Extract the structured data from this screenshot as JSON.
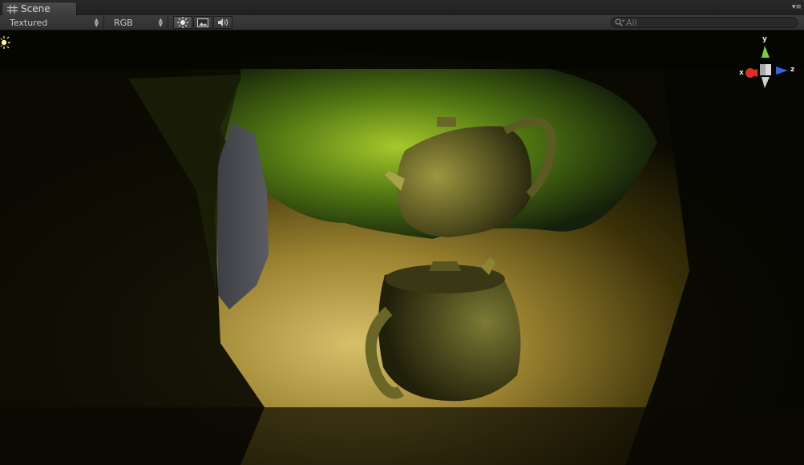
{
  "tab": {
    "title": "Scene"
  },
  "toolbar": {
    "render_mode": "Textured",
    "channel": "RGB",
    "search_placeholder": "All"
  },
  "gizmo": {
    "x_label": "x",
    "y_label": "y",
    "z_label": "z"
  },
  "colors": {
    "sky_edge": "#4a4c52",
    "sand": "#c8b060",
    "grass": "#7aa024",
    "teapot": "#8a8a3a"
  },
  "icons": [
    "hash-icon",
    "menu-icon",
    "sun-lighting-icon",
    "image-icon",
    "audio-icon",
    "search-icon",
    "scene-light-icon",
    "orientation-gizmo"
  ]
}
